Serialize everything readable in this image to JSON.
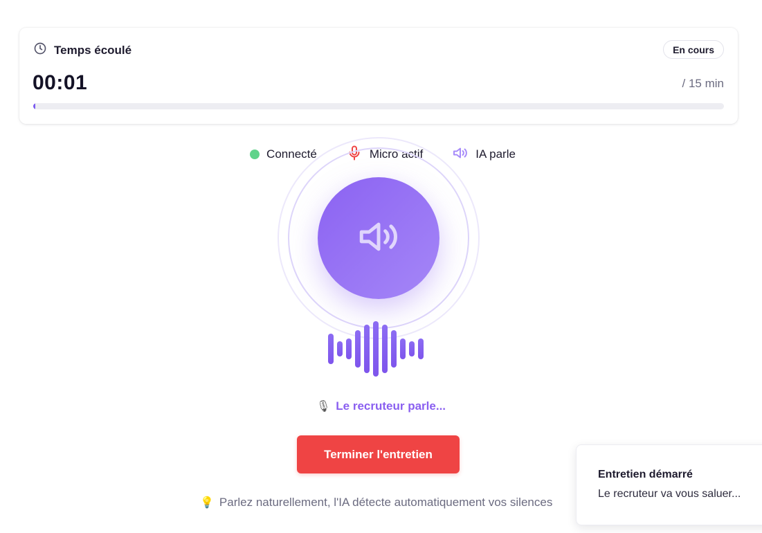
{
  "timer": {
    "title": "Temps écoulé",
    "status": "En cours",
    "elapsed": "00:01",
    "duration": "/ 15 min",
    "progress_percent": 0.1
  },
  "status_row": {
    "connected": "Connecté",
    "mic": "Micro actif",
    "ai": "IA parle"
  },
  "speaking": {
    "label": "Le recruteur parle..."
  },
  "actions": {
    "end_label": "Terminer l'entretien"
  },
  "hint": {
    "text": "Parlez naturellement, l'IA détecte automatiquement vos silences"
  },
  "toast": {
    "title": "Entretien démarré",
    "body": "Le recruteur va vous saluer..."
  },
  "colors": {
    "accent": "#8b62f2",
    "danger": "#ef4444",
    "connected": "#5fd38a",
    "mic": "#ef4444"
  },
  "icons": [
    "clock-icon",
    "microphone-icon",
    "speaker-icon",
    "studio-microphone-icon",
    "lightbulb-icon"
  ]
}
